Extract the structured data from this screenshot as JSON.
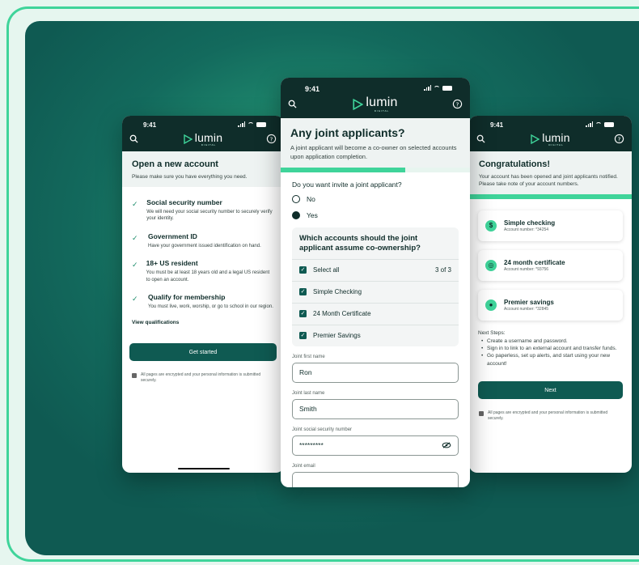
{
  "status_time": "9:41",
  "brand": {
    "name": "lumin",
    "sub": "DIGITAL"
  },
  "left": {
    "title": "Open a new account",
    "subtitle": "Please make sure you have everything you need.",
    "checks": [
      {
        "title": "Social security number",
        "desc": "We will need your social security number to securely verify your identity."
      },
      {
        "title": "Government ID",
        "desc": "Have your government issued identification on hand."
      },
      {
        "title": "18+ US resident",
        "desc": "You must be at least 18 years old and a legal US resident to open an account."
      },
      {
        "title": "Qualify for membership",
        "desc": "You must live, work, worship, or go to school in our region."
      }
    ],
    "view_link": "View qualifications",
    "cta": "Get started",
    "security_note": "All pages are encrypted and your personal information is submitted securely."
  },
  "center": {
    "title": "Any joint applicants?",
    "subtitle": "A joint applicant will become a co-owner on selected accounts upon application completion.",
    "progress_pct": 66,
    "question": "Do you want invite a joint applicant?",
    "options": [
      "No",
      "Yes"
    ],
    "selected_option": "Yes",
    "accounts_title": "Which accounts should the joint applicant assume co-ownership?",
    "select_all": "Select all",
    "select_count": "3 of 3",
    "accounts": [
      "Simple Checking",
      "24 Month Certificate",
      "Premier Savings"
    ],
    "fields": [
      {
        "label": "Joint first name",
        "value": "Ron"
      },
      {
        "label": "Joint last name",
        "value": "Smith"
      },
      {
        "label": "Joint social security number",
        "value": "*********"
      },
      {
        "label": "Joint email",
        "value": ""
      }
    ]
  },
  "right": {
    "title": "Congratulations!",
    "subtitle": "Your account has been opened and joint applicants notified. Please take note of your account numbers.",
    "accounts": [
      {
        "name": "Simple checking",
        "number": "Account number: *34254",
        "icon": "$"
      },
      {
        "name": "24 month certificate",
        "number": "Account number: *93756",
        "icon": "◎"
      },
      {
        "name": "Premier savings",
        "number": "Account number: *32845",
        "icon": "●"
      }
    ],
    "next_steps_title": "Next Steps:",
    "next_steps": [
      "Create a username and password.",
      "Sign in to link to an external account and transfer funds.",
      "Go paperless, set up alerts, and start using your new account!"
    ],
    "cta": "Next",
    "security_note": "All pages are encrypted and your personal information is submitted securely."
  },
  "colors": {
    "dark": "#0f2d2a",
    "accent": "#3fd49a",
    "button": "#0f5a52"
  }
}
